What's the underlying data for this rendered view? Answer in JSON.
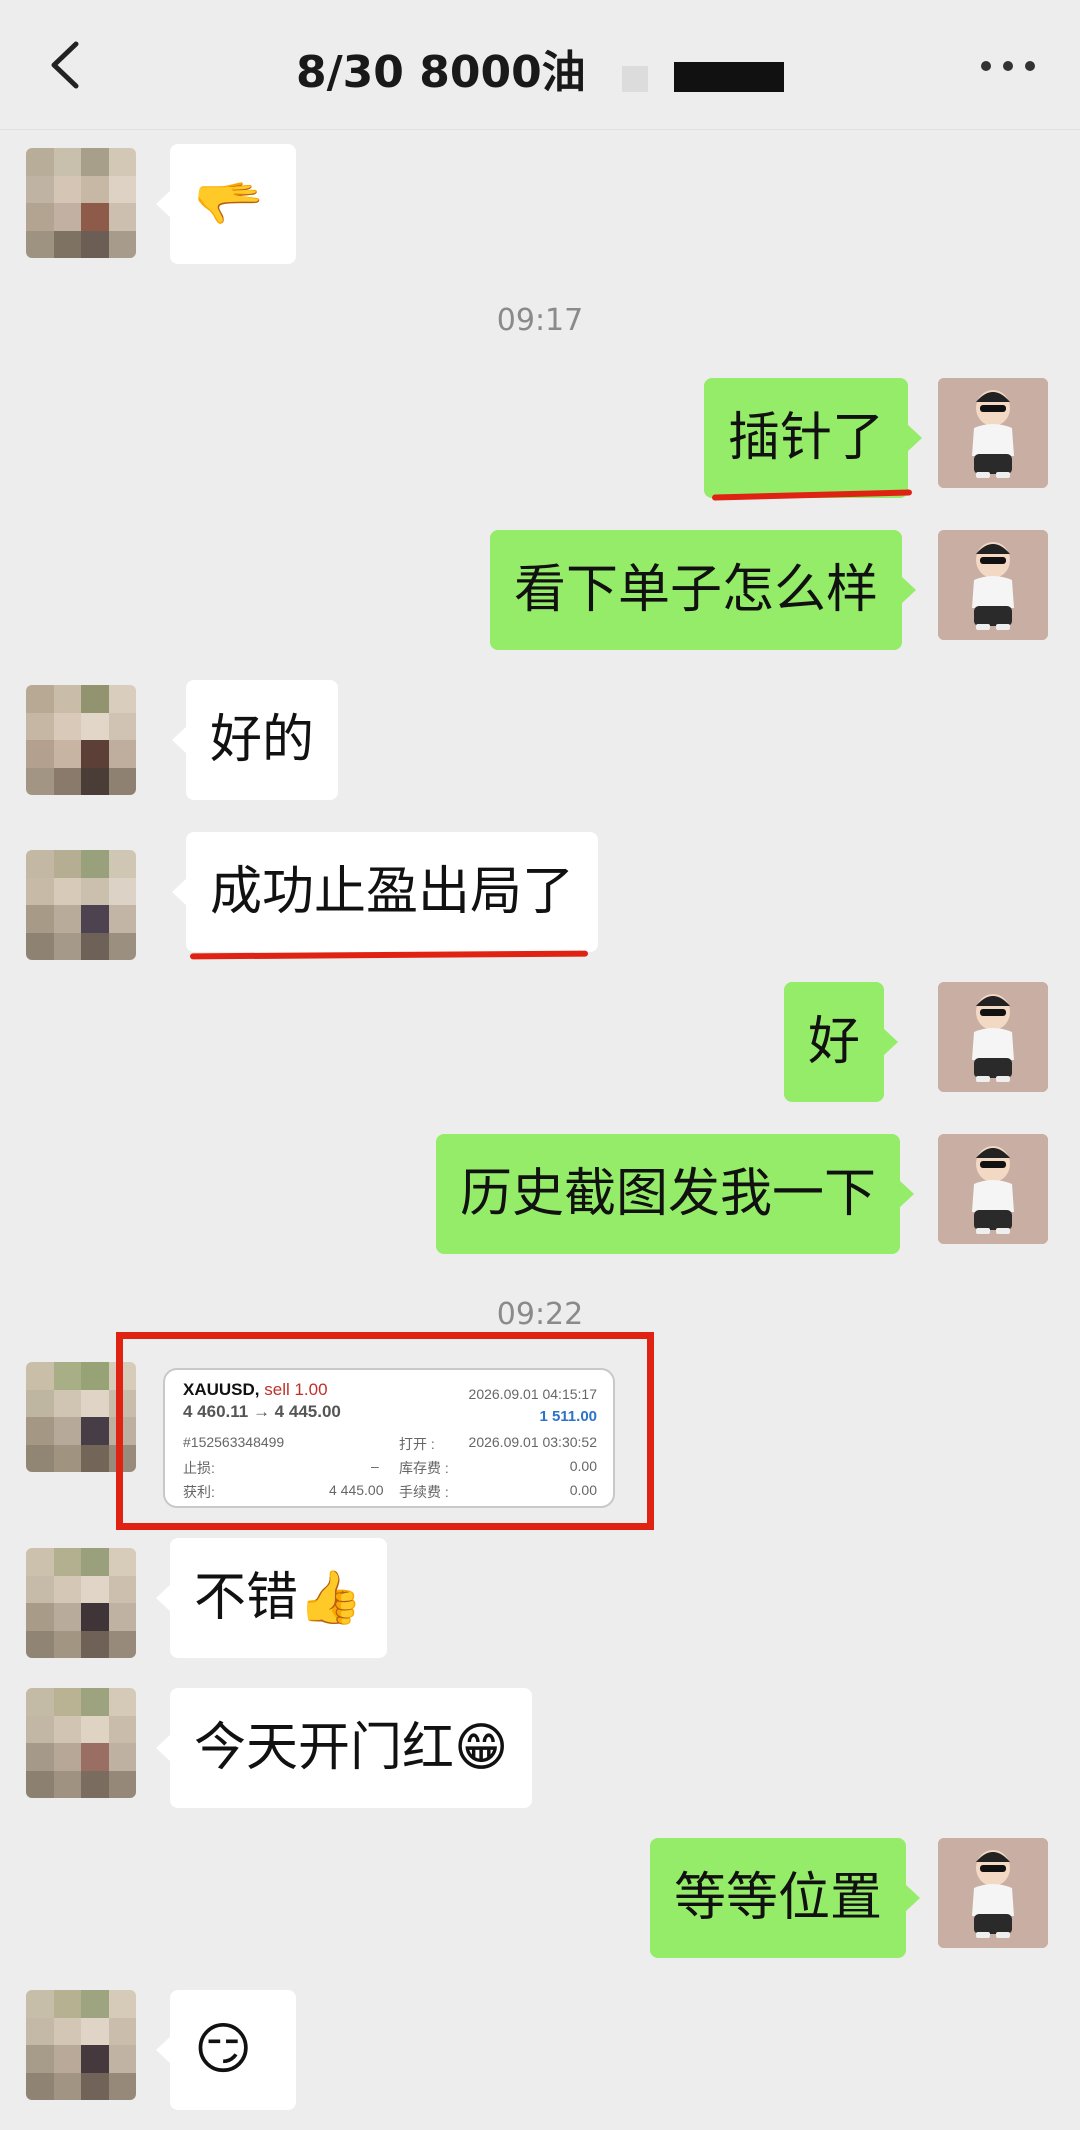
{
  "header": {
    "title": "8/30  8000油"
  },
  "times": {
    "t1": "09:17",
    "t2": "09:22"
  },
  "messages": {
    "m1_emoji": "🫳",
    "m2": "插针了",
    "m3": "看下单子怎么样",
    "m4": "好的",
    "m5": "成功止盈出局了",
    "m6": "好",
    "m7": "历史截图发我一下",
    "m9": "不错👍",
    "m10": "今天开门红😁",
    "m11": "等等位置",
    "m12_emoji": "😏"
  },
  "trade_card": {
    "symbol": "XAUUSD,",
    "side": "sell 1.00",
    "prices": "4 460.11 → 4 445.00",
    "close_time": "2026.09.01 04:15:17",
    "profit": "1 511.00",
    "ticket": "#152563348499",
    "open_label": "打开 :",
    "open_time": "2026.09.01 03:30:52",
    "sl_label": "止损:",
    "sl_value": "–",
    "swap_label": "库存费 :",
    "swap_value": "0.00",
    "tp_label": "获利:",
    "tp_value": "4 445.00",
    "fee_label": "手续费 :",
    "fee_value": "0.00"
  },
  "colors": {
    "green_bubble": "#95ec69",
    "accent_red": "#e02213",
    "profit_blue": "#2d74c8"
  }
}
